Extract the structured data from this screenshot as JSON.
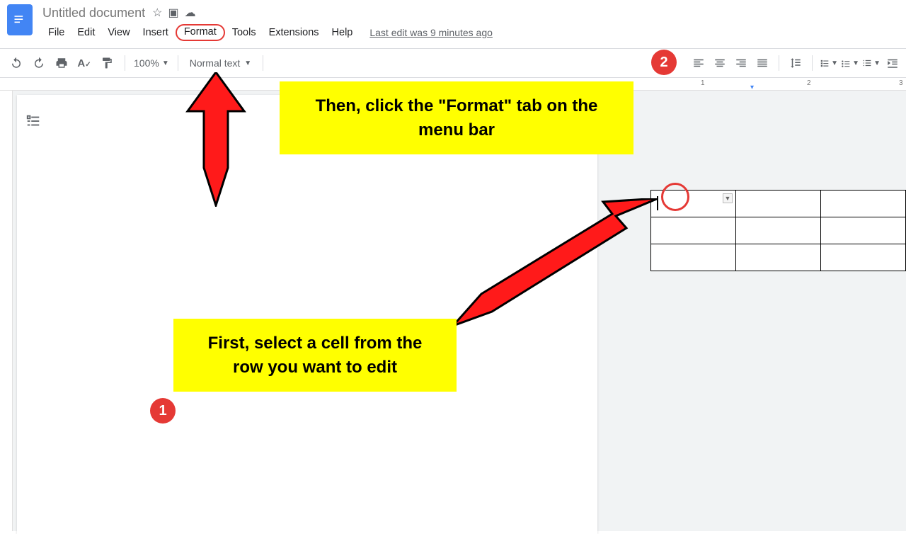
{
  "header": {
    "doc_title": "Untitled document",
    "menu": {
      "file": "File",
      "edit": "Edit",
      "view": "View",
      "insert": "Insert",
      "format": "Format",
      "tools": "Tools",
      "extensions": "Extensions",
      "help": "Help"
    },
    "last_edit": "Last edit was 9 minutes ago"
  },
  "toolbar": {
    "zoom": "100%",
    "style_name": "Normal text"
  },
  "ruler": {
    "num1": "1",
    "num2": "2",
    "num3": "3"
  },
  "annotations": {
    "callout2": "Then, click the \"Format\" tab on the menu bar",
    "callout1": "First, select a cell from the row you want to edit",
    "badge1": "1",
    "badge2": "2"
  },
  "colors": {
    "accent_red": "#e53935",
    "highlight_yellow": "#ffff00",
    "docs_blue": "#4285f4"
  }
}
